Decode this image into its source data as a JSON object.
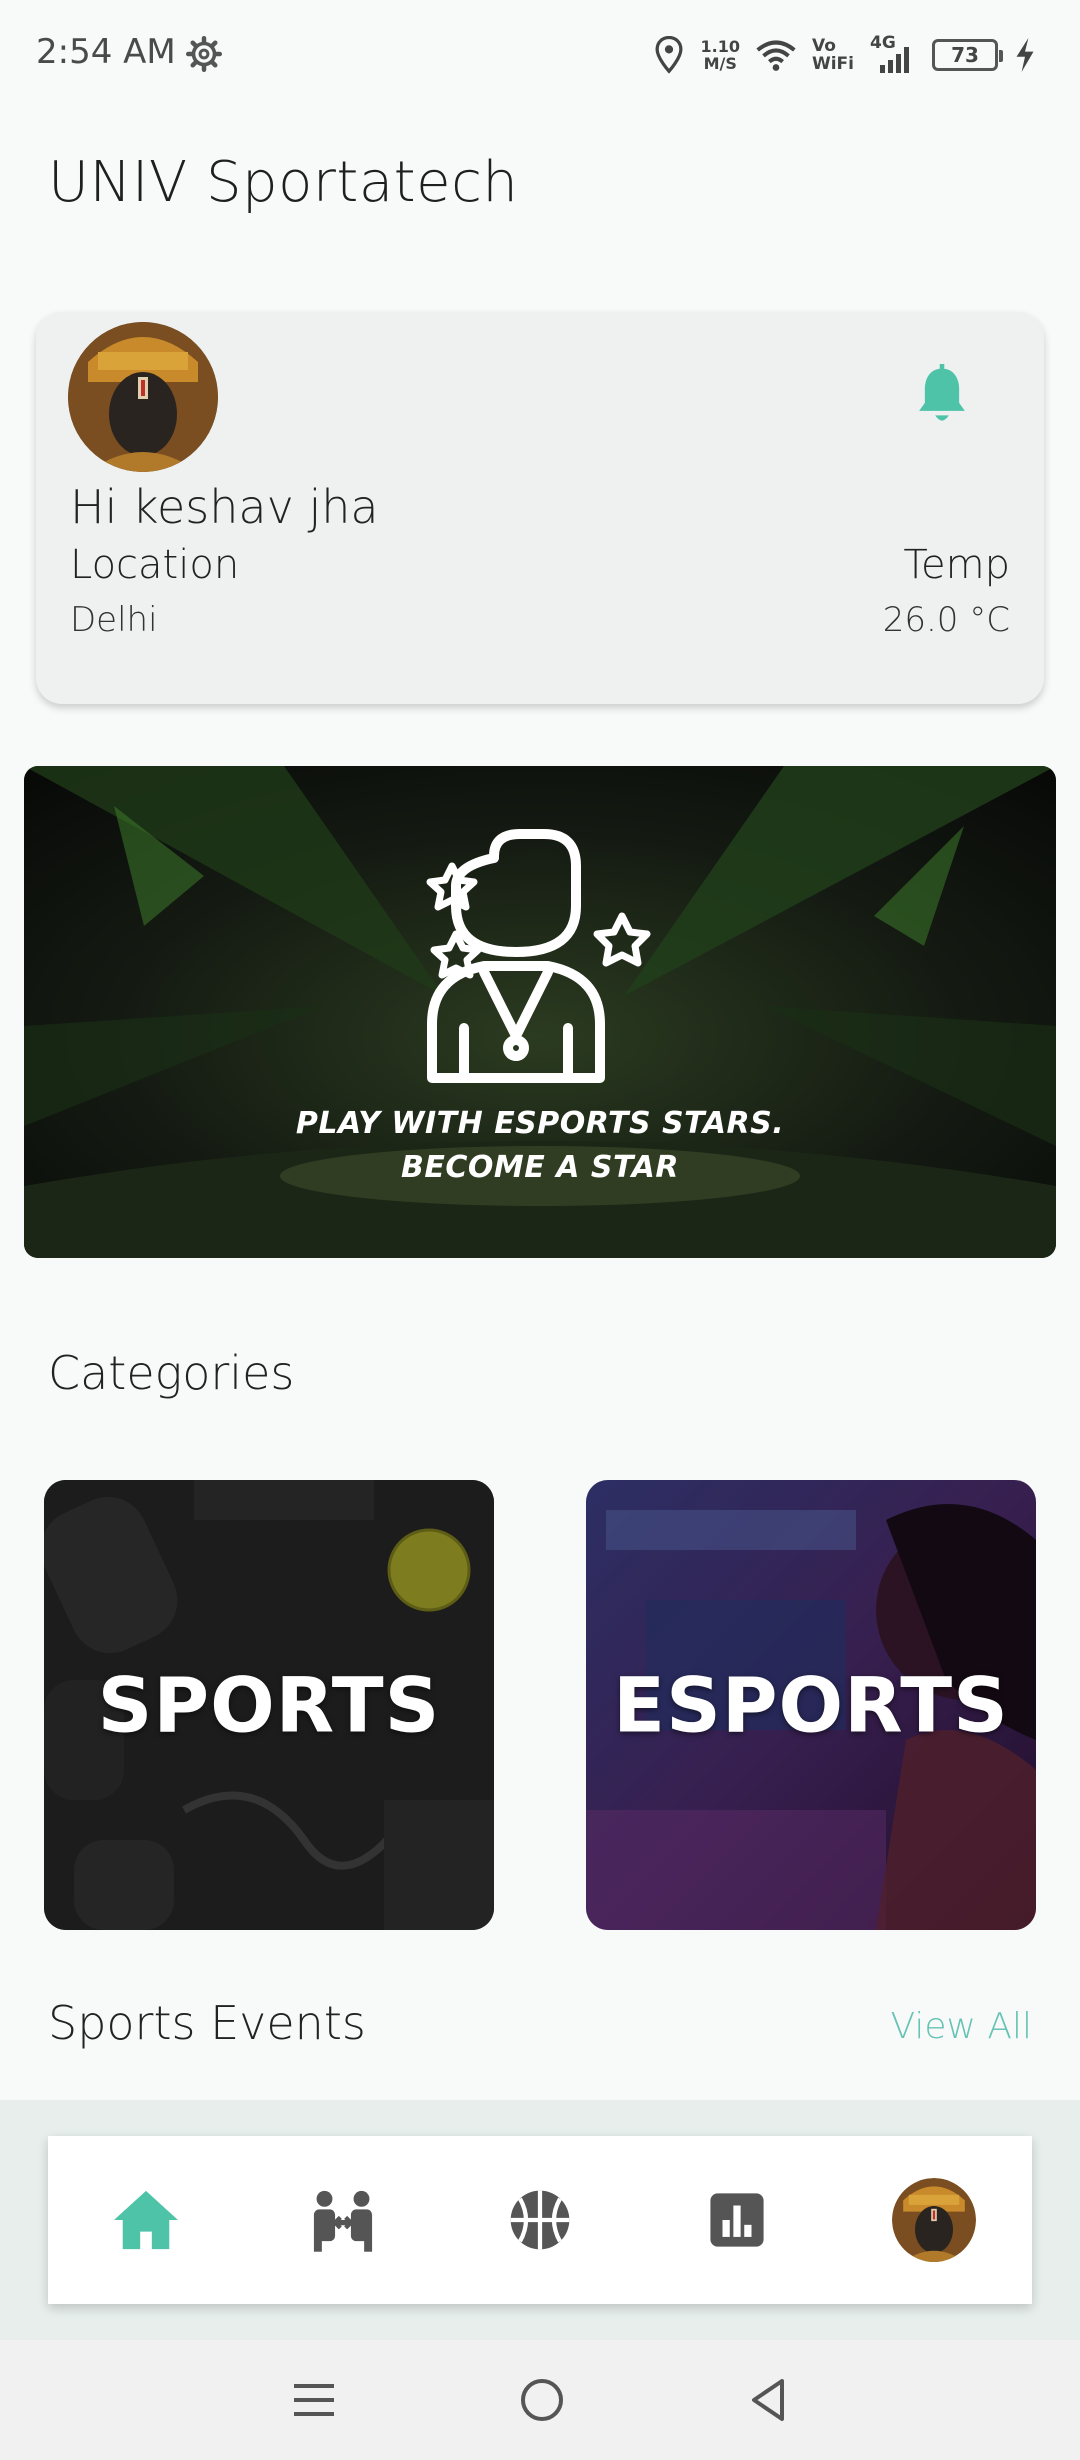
{
  "status_bar": {
    "time": "2:54 AM",
    "speed_value": "1.10",
    "speed_unit": "M/S",
    "vowifi_top": "Vo",
    "vowifi_bottom": "WiFi",
    "network": "4G",
    "battery": "73"
  },
  "app": {
    "title": "UNIV Sportatech"
  },
  "profile": {
    "greeting": "Hi keshav jha",
    "location_label": "Location",
    "location_value": "Delhi",
    "temp_label": "Temp",
    "temp_value": "26.0 °C"
  },
  "banner": {
    "line1": "PLAY WITH ESPORTS STARS.",
    "line2": "BECOME A STAR"
  },
  "categories": {
    "title": "Categories",
    "items": [
      {
        "label": "SPORTS"
      },
      {
        "label": "ESPORTS"
      }
    ]
  },
  "events": {
    "title": "Sports Events",
    "view_all": "View All"
  },
  "bottom_nav": {
    "items": [
      {
        "icon": "home-icon",
        "active": true
      },
      {
        "icon": "fitness-icon",
        "active": false
      },
      {
        "icon": "basketball-icon",
        "active": false
      },
      {
        "icon": "stats-icon",
        "active": false
      },
      {
        "icon": "profile-avatar",
        "active": false
      }
    ]
  },
  "colors": {
    "accent": "#4fc3a8",
    "icon_inactive": "#555555",
    "background": "#f8faf9",
    "card": "#eef1f0"
  }
}
